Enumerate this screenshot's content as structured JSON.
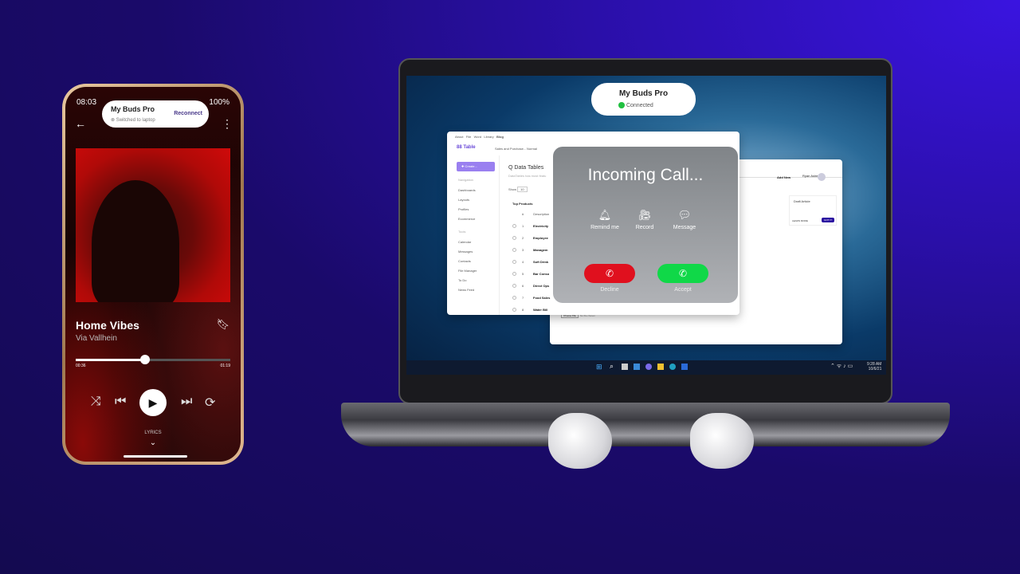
{
  "phone": {
    "time": "08:03",
    "battery": "100%",
    "notification": {
      "title": "My Buds Pro",
      "subtitle": "Switched to laptop",
      "action": "Reconnect"
    },
    "track": {
      "title": "Home Vibes",
      "artist": "Via Vallhein",
      "elapsed": "00:36",
      "duration": "01:19",
      "progress": 0.45
    },
    "lyrics_label": "LYRICS"
  },
  "laptop": {
    "toast": {
      "title": "My Buds Pro",
      "status": "Connected"
    },
    "app": {
      "menu": [
        "About",
        "File",
        "Word",
        "Library",
        "Blog"
      ],
      "logo": "Table",
      "doc": "Sales and Purchase...",
      "mode": "Normal",
      "create": "Create...",
      "nav_heading": "Navigation",
      "nav": [
        "Dashboards",
        "Layouts",
        "Profiles",
        "Ecommerce"
      ],
      "tools_heading": "Tools",
      "tools": [
        "Calendar",
        "Messages",
        "Contacts",
        "File Manager",
        "To Do",
        "News Feed"
      ],
      "title": "Q Data Tables",
      "subtitle": "DataTables has most featu",
      "show": "Show",
      "entries": "10",
      "section": "Top Products",
      "col_num": "#",
      "col_desc": "Description",
      "rows": [
        {
          "n": "1",
          "d": "Electricity"
        },
        {
          "n": "2",
          "d": "Employee"
        },
        {
          "n": "3",
          "d": "Managem"
        },
        {
          "n": "4",
          "d": "Soft Drink"
        },
        {
          "n": "5",
          "d": "Bar Conso"
        },
        {
          "n": "6",
          "d": "Direct Ops"
        },
        {
          "n": "7",
          "d": "Food Sales"
        },
        {
          "n": "8",
          "d": "Water Bill"
        }
      ]
    },
    "editor": {
      "add_new": "Add New",
      "user": "Ryan Asher",
      "draft_title": "Draft Article",
      "learn_more": "LEARN MORE",
      "got_it": "GOT IT",
      "cover": "Cover Article",
      "choose_file": "Choose File",
      "no_file": "No file chosen"
    },
    "call": {
      "title": "Incoming Call...",
      "actions": [
        {
          "label": "Remind me",
          "icon": "bell-icon"
        },
        {
          "label": "Record",
          "icon": "video-camera-icon"
        },
        {
          "label": "Message",
          "icon": "chat-bubble-icon"
        }
      ],
      "decline": "Decline",
      "accept": "Accept",
      "decline_color": "#e0101e",
      "accept_color": "#10d848"
    },
    "taskbar": {
      "time": "9:28 AM",
      "date": "10/6/21"
    }
  }
}
